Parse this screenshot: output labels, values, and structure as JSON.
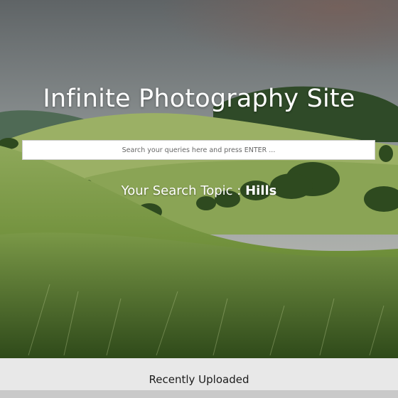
{
  "site": {
    "title": "Infinite Photography Site"
  },
  "search": {
    "placeholder": "Search your queries here and press ENTER ...",
    "value": ""
  },
  "topic": {
    "prefix": "Your Search Topic : ",
    "value": "Hills"
  },
  "recent": {
    "heading": "Recently Uploaded"
  },
  "colors": {
    "sky_top": "#6c6f70",
    "hill_green": "#6f8f3a",
    "footer_bg": "#e8e8e8"
  }
}
